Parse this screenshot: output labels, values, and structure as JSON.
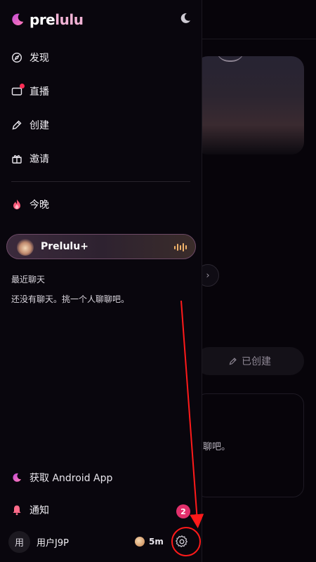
{
  "app": {
    "logo_part1": "pre",
    "logo_part2": "lulu",
    "brand_color": "#f0b2d4",
    "accent_color": "#e2306c"
  },
  "nav": {
    "items": [
      {
        "label": "发现",
        "icon": "compass-icon"
      },
      {
        "label": "直播",
        "icon": "tv-icon"
      },
      {
        "label": "创建",
        "icon": "pen-icon"
      },
      {
        "label": "邀请",
        "icon": "gift-icon"
      }
    ],
    "tonight": {
      "label": "今晚",
      "icon": "flame-icon"
    }
  },
  "plus": {
    "label": "Prelulu+"
  },
  "recent_chats": {
    "title": "最近聊天",
    "empty_text": "还没有聊天。挑一个人聊聊吧。"
  },
  "footer": {
    "android_label": "获取 Android App",
    "notifications_label": "通知",
    "notifications_count": "2",
    "user_avatar_text": "用",
    "user_name": "用户J9P",
    "coin_value": "5m"
  },
  "background": {
    "created_label": "已创建",
    "card_text": "聊吧。"
  }
}
